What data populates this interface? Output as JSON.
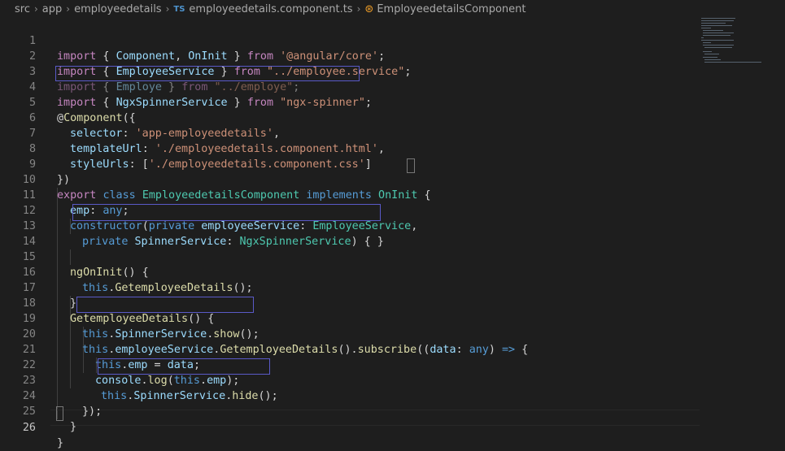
{
  "breadcrumb": {
    "parts": [
      "src",
      "app",
      "employeedetails",
      "employeedetails.component.ts",
      "EmployeedetailsComponent"
    ],
    "ts_badge": "TS",
    "class_icon": "⊛"
  },
  "code": {
    "line_numbers": [
      "1",
      "2",
      "3",
      "4",
      "5",
      "6",
      "7",
      "8",
      "9",
      "10",
      "11",
      "12",
      "13",
      "14",
      "15",
      "16",
      "17",
      "18",
      "19",
      "20",
      "21",
      "22",
      "23",
      "24",
      "25",
      "26"
    ],
    "l1": {
      "import": "import",
      "p1": " { ",
      "a": "Component",
      "p2": ", ",
      "b": "OnInit",
      "p3": " } ",
      "from": "from",
      "sp": " ",
      "str": "'@angular/core'",
      "end": ";"
    },
    "l2": {
      "import": "import",
      "p1": " { ",
      "a": "EmployeeService",
      "p3": " } ",
      "from": "from",
      "sp": " ",
      "str": "\"../employee.service\"",
      "end": ";"
    },
    "l3": {
      "import": "import",
      "p1": " { ",
      "a": "Employe",
      "p3": " } ",
      "from": "from",
      "sp": " ",
      "str": "\"../employe\"",
      "end": ";"
    },
    "l4": {
      "import": "import",
      "p1": " { ",
      "a": "NgxSpinnerService",
      "p3": " } ",
      "from": "from",
      "sp": " ",
      "str": "\"ngx-spinner\"",
      "end": ";"
    },
    "l5": {
      "at": "@",
      "fn": "Component",
      "end": "({"
    },
    "l6": {
      "key": "selector",
      "p": ": ",
      "str": "'app-employeedetails'",
      "end": ","
    },
    "l7": {
      "key": "templateUrl",
      "p": ": ",
      "str": "'./employeedetails.component.html'",
      "end": ","
    },
    "l8": {
      "key": "styleUrls",
      "p": ": [",
      "str": "'./employeedetails.component.css'",
      "end": "]"
    },
    "l9": {
      "text": "})"
    },
    "l10": {
      "export": "export",
      "sp1": " ",
      "class": "class",
      "sp2": " ",
      "name": "EmployeedetailsComponent",
      "sp3": " ",
      "implements": "implements",
      "sp4": " ",
      "iface": "OnInit",
      "end": " {"
    },
    "l11": {
      "var": "emp",
      "p": ": ",
      "type": "any",
      "end": ";"
    },
    "l12": {
      "ctor": "constructor",
      "p1": "(",
      "priv": "private",
      "sp": " ",
      "var": "employeeService",
      "p2": ": ",
      "type": "EmployeeService",
      "end": ","
    },
    "l13": {
      "priv": "private",
      "sp": " ",
      "var": "SpinnerService",
      "p2": ": ",
      "type": "NgxSpinnerService",
      "end": ") { }"
    },
    "l15": {
      "fn": "ngOnInit",
      "end": "() {"
    },
    "l16": {
      "this": "this",
      "dot": ".",
      "fn": "GetemployeeDetails",
      "end": "();"
    },
    "l17": {
      "text": "}"
    },
    "l18": {
      "fn": "GetemployeeDetails",
      "end": "() {"
    },
    "l19": {
      "this": "this",
      "dot": ".",
      "var": "SpinnerService",
      "dot2": ".",
      "fn": "show",
      "end": "();"
    },
    "l20": {
      "this": "this",
      "dot": ".",
      "var": "employeeService",
      "dot2": ".",
      "fn": "GetemployeeDetails",
      "p1": "().",
      "fn2": "subscribe",
      "p2": "((",
      "param": "data",
      "p3": ": ",
      "type": "any",
      "p4": ") ",
      "arrow": "=>",
      "end": " {"
    },
    "l21": {
      "this": "this",
      "dot": ".",
      "var": "emp",
      "p": " = ",
      "var2": "data",
      "end": ";"
    },
    "l22": {
      "var": "console",
      "dot": ".",
      "fn": "log",
      "p1": "(",
      "this": "this",
      "dot2": ".",
      "var2": "emp",
      "end": ");"
    },
    "l23": {
      "this": "this",
      "dot": ".",
      "var": "SpinnerService",
      "dot2": ".",
      "fn": "hide",
      "end": "();"
    },
    "l24": {
      "text": "});"
    },
    "l25": {
      "text": "}"
    },
    "l26": {
      "text": "}"
    }
  }
}
